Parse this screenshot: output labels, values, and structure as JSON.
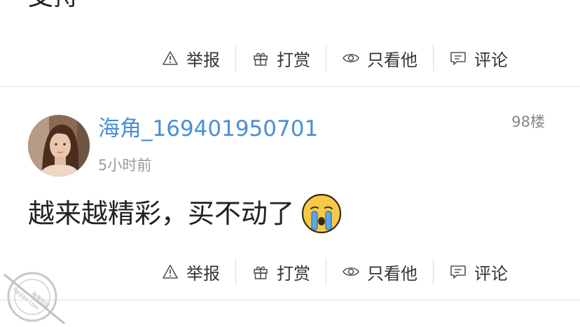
{
  "previous_post": {
    "text_fragment": "支持"
  },
  "actions": {
    "report_label": "举报",
    "reward_label": "打赏",
    "only_him_label": "只看他",
    "comment_label": "评论"
  },
  "reply": {
    "username": "海角_169401950701",
    "time": "5小时前",
    "floor": "98楼",
    "content": "越来越精彩，买不动了",
    "emoji": "crying-face"
  },
  "watermark": {
    "line1": "海角社区",
    "line2": "haijiao.com"
  },
  "colors": {
    "username": "#4a8fd4",
    "muted": "#9a9a9a",
    "divider": "#e2e2e2"
  }
}
